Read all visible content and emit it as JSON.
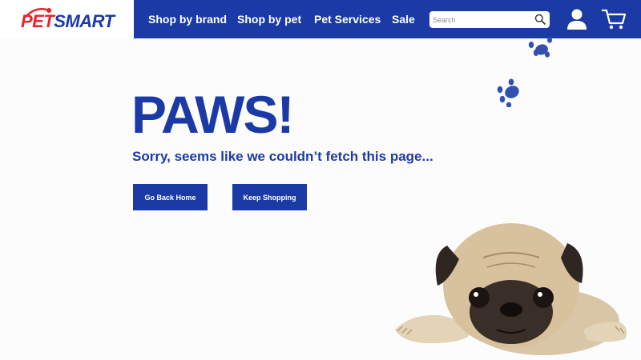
{
  "brand": {
    "logo_text_pet": "PET",
    "logo_text_smart": "SMART",
    "logo_red": "#e4262d",
    "primary_blue": "#1b3aa6"
  },
  "nav": {
    "items": [
      {
        "label": "Shop by brand"
      },
      {
        "label": "Shop by pet"
      },
      {
        "label": "Pet Services"
      },
      {
        "label": "Sale"
      }
    ],
    "search": {
      "placeholder": "Search",
      "icon": "search-icon"
    },
    "icons": [
      "user-icon",
      "cart-icon"
    ]
  },
  "error": {
    "headline": "PAWS!",
    "message": "Sorry, seems like we couldn’t fetch this page...",
    "buttons": [
      {
        "label": "Go Back Home"
      },
      {
        "label": "Keep Shopping"
      }
    ]
  },
  "decor": {
    "paw_prints": [
      "paw-print-icon",
      "paw-print-icon"
    ],
    "image": "sad-pug-photo"
  }
}
